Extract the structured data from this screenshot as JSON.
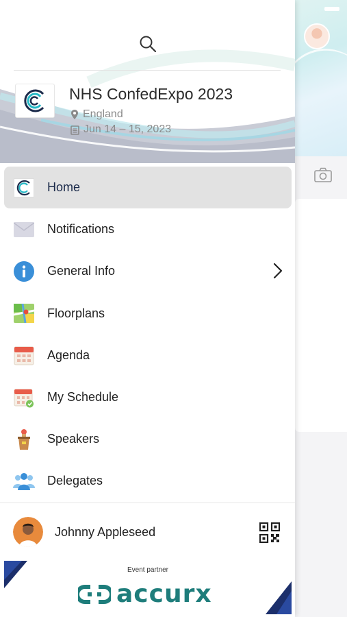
{
  "event": {
    "title": "NHS ConfedExpo 2023",
    "location": "England",
    "dates": "Jun 14 – 15, 2023",
    "logo_icon": "event-logo-c-icon"
  },
  "search": {
    "icon": "search-icon"
  },
  "menu": {
    "items": [
      {
        "label": "Home",
        "icon": "event-logo-c-icon",
        "active": true
      },
      {
        "label": "Notifications",
        "icon": "envelope-icon"
      },
      {
        "label": "General Info",
        "icon": "info-icon",
        "has_submenu": true
      },
      {
        "label": "Floorplans",
        "icon": "map-icon"
      },
      {
        "label": "Agenda",
        "icon": "calendar-icon"
      },
      {
        "label": "My Schedule",
        "icon": "calendar-check-icon"
      },
      {
        "label": "Speakers",
        "icon": "podium-icon"
      },
      {
        "label": "Delegates",
        "icon": "people-icon"
      }
    ]
  },
  "user": {
    "name": "Johnny Appleseed",
    "qr_icon": "qr-code-icon"
  },
  "partner": {
    "label": "Event partner",
    "name": "accurx"
  },
  "colors": {
    "active_bg": "#e2e2e2",
    "accent_teal": "#1e7d7b",
    "info_blue": "#3a8fd8",
    "text_gray": "#8a8a8a"
  }
}
